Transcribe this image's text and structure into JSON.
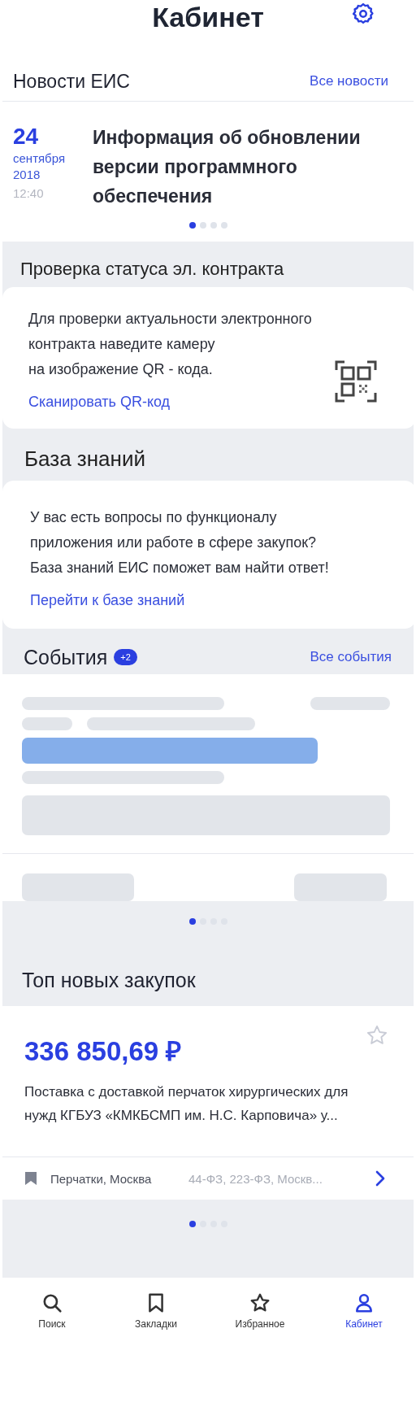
{
  "header": {
    "title": "Кабинет"
  },
  "news": {
    "title": "Новости ЕИС",
    "link": "Все новости",
    "items": [
      {
        "day": "24",
        "month": "сентября",
        "year": "2018",
        "time": "12:40",
        "headline": "Информация об обновлении версии программного обеспечения"
      }
    ],
    "dots": [
      {
        "selected": true
      },
      {
        "selected": false
      },
      {
        "selected": false
      },
      {
        "selected": false
      }
    ]
  },
  "contract_check": {
    "title": "Проверка статуса эл. контракта",
    "lines": [
      "Для проверки актуальности  электронного",
      "контракта наведите камеру",
      "на изображение QR - кода."
    ],
    "link": "Сканировать QR-код"
  },
  "knowledge_base": {
    "title": "База знаний",
    "lines": [
      "У вас есть вопросы по функционалу",
      "приложения или работе в сфере закупок?",
      "База знаний ЕИС поможет вам найти ответ!"
    ],
    "link": "Перейти к базе знаний"
  },
  "events": {
    "title": "События",
    "badge": "+2",
    "link": "Все события",
    "dots": [
      {
        "selected": true
      },
      {
        "selected": false
      },
      {
        "selected": false
      },
      {
        "selected": false
      }
    ]
  },
  "top_purchases": {
    "title": "Топ новых закупок",
    "items": [
      {
        "price": "336 850,69 ₽",
        "favorite": false,
        "description_lines": [
          "Поставка с доставкой перчаток хирургических для",
          "нужд КГБУЗ «КМКБСМП им. Н.С. Карповича» у..."
        ],
        "tag": "Перчатки, Москва",
        "laws": "44-ФЗ, 223-ФЗ, Москв..."
      }
    ],
    "dots": [
      {
        "selected": true
      },
      {
        "selected": false
      },
      {
        "selected": false
      },
      {
        "selected": false
      }
    ]
  },
  "tab_bar": [
    {
      "label": "Поиск",
      "selected": false
    },
    {
      "label": "Закладки",
      "selected": false
    },
    {
      "label": "Избранное",
      "selected": false
    },
    {
      "label": "Кабинет",
      "selected": true
    }
  ]
}
